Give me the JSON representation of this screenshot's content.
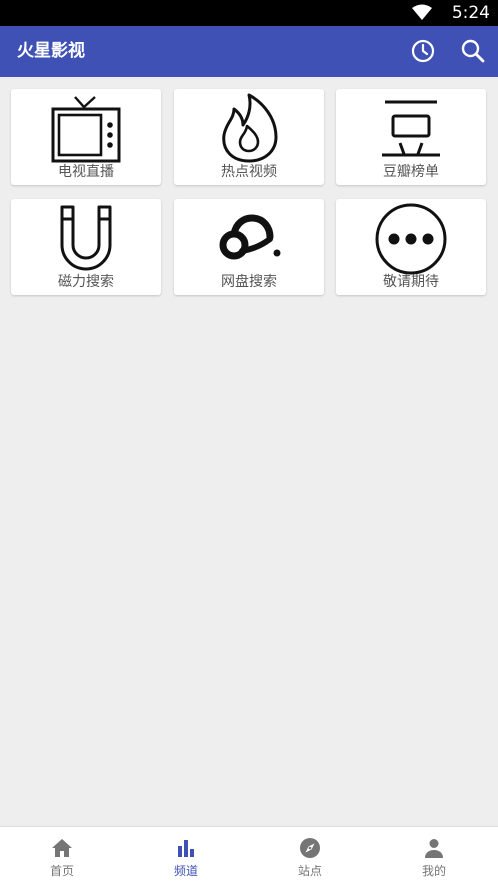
{
  "status_bar": {
    "time": "5:24",
    "wifi_icon": "wifi-icon"
  },
  "app_bar": {
    "title": "火星影视",
    "actions": [
      {
        "icon": "history-icon"
      },
      {
        "icon": "search-icon"
      }
    ],
    "color": "#3f51b5"
  },
  "channels": [
    {
      "label": "电视直播",
      "icon": "tv-icon"
    },
    {
      "label": "热点视频",
      "icon": "flame-icon"
    },
    {
      "label": "豆瓣榜单",
      "icon": "douban-icon"
    },
    {
      "label": "磁力搜索",
      "icon": "magnet-icon"
    },
    {
      "label": "网盘搜索",
      "icon": "cloud-drive-icon"
    },
    {
      "label": "敬请期待",
      "icon": "more-icon"
    }
  ],
  "bottom_nav": {
    "items": [
      {
        "label": "首页",
        "icon": "home-icon",
        "active": false
      },
      {
        "label": "频道",
        "icon": "bar-chart-icon",
        "active": true
      },
      {
        "label": "站点",
        "icon": "compass-icon",
        "active": false
      },
      {
        "label": "我的",
        "icon": "person-icon",
        "active": false
      }
    ],
    "active_color": "#3f51b5",
    "inactive_color": "#757575"
  }
}
